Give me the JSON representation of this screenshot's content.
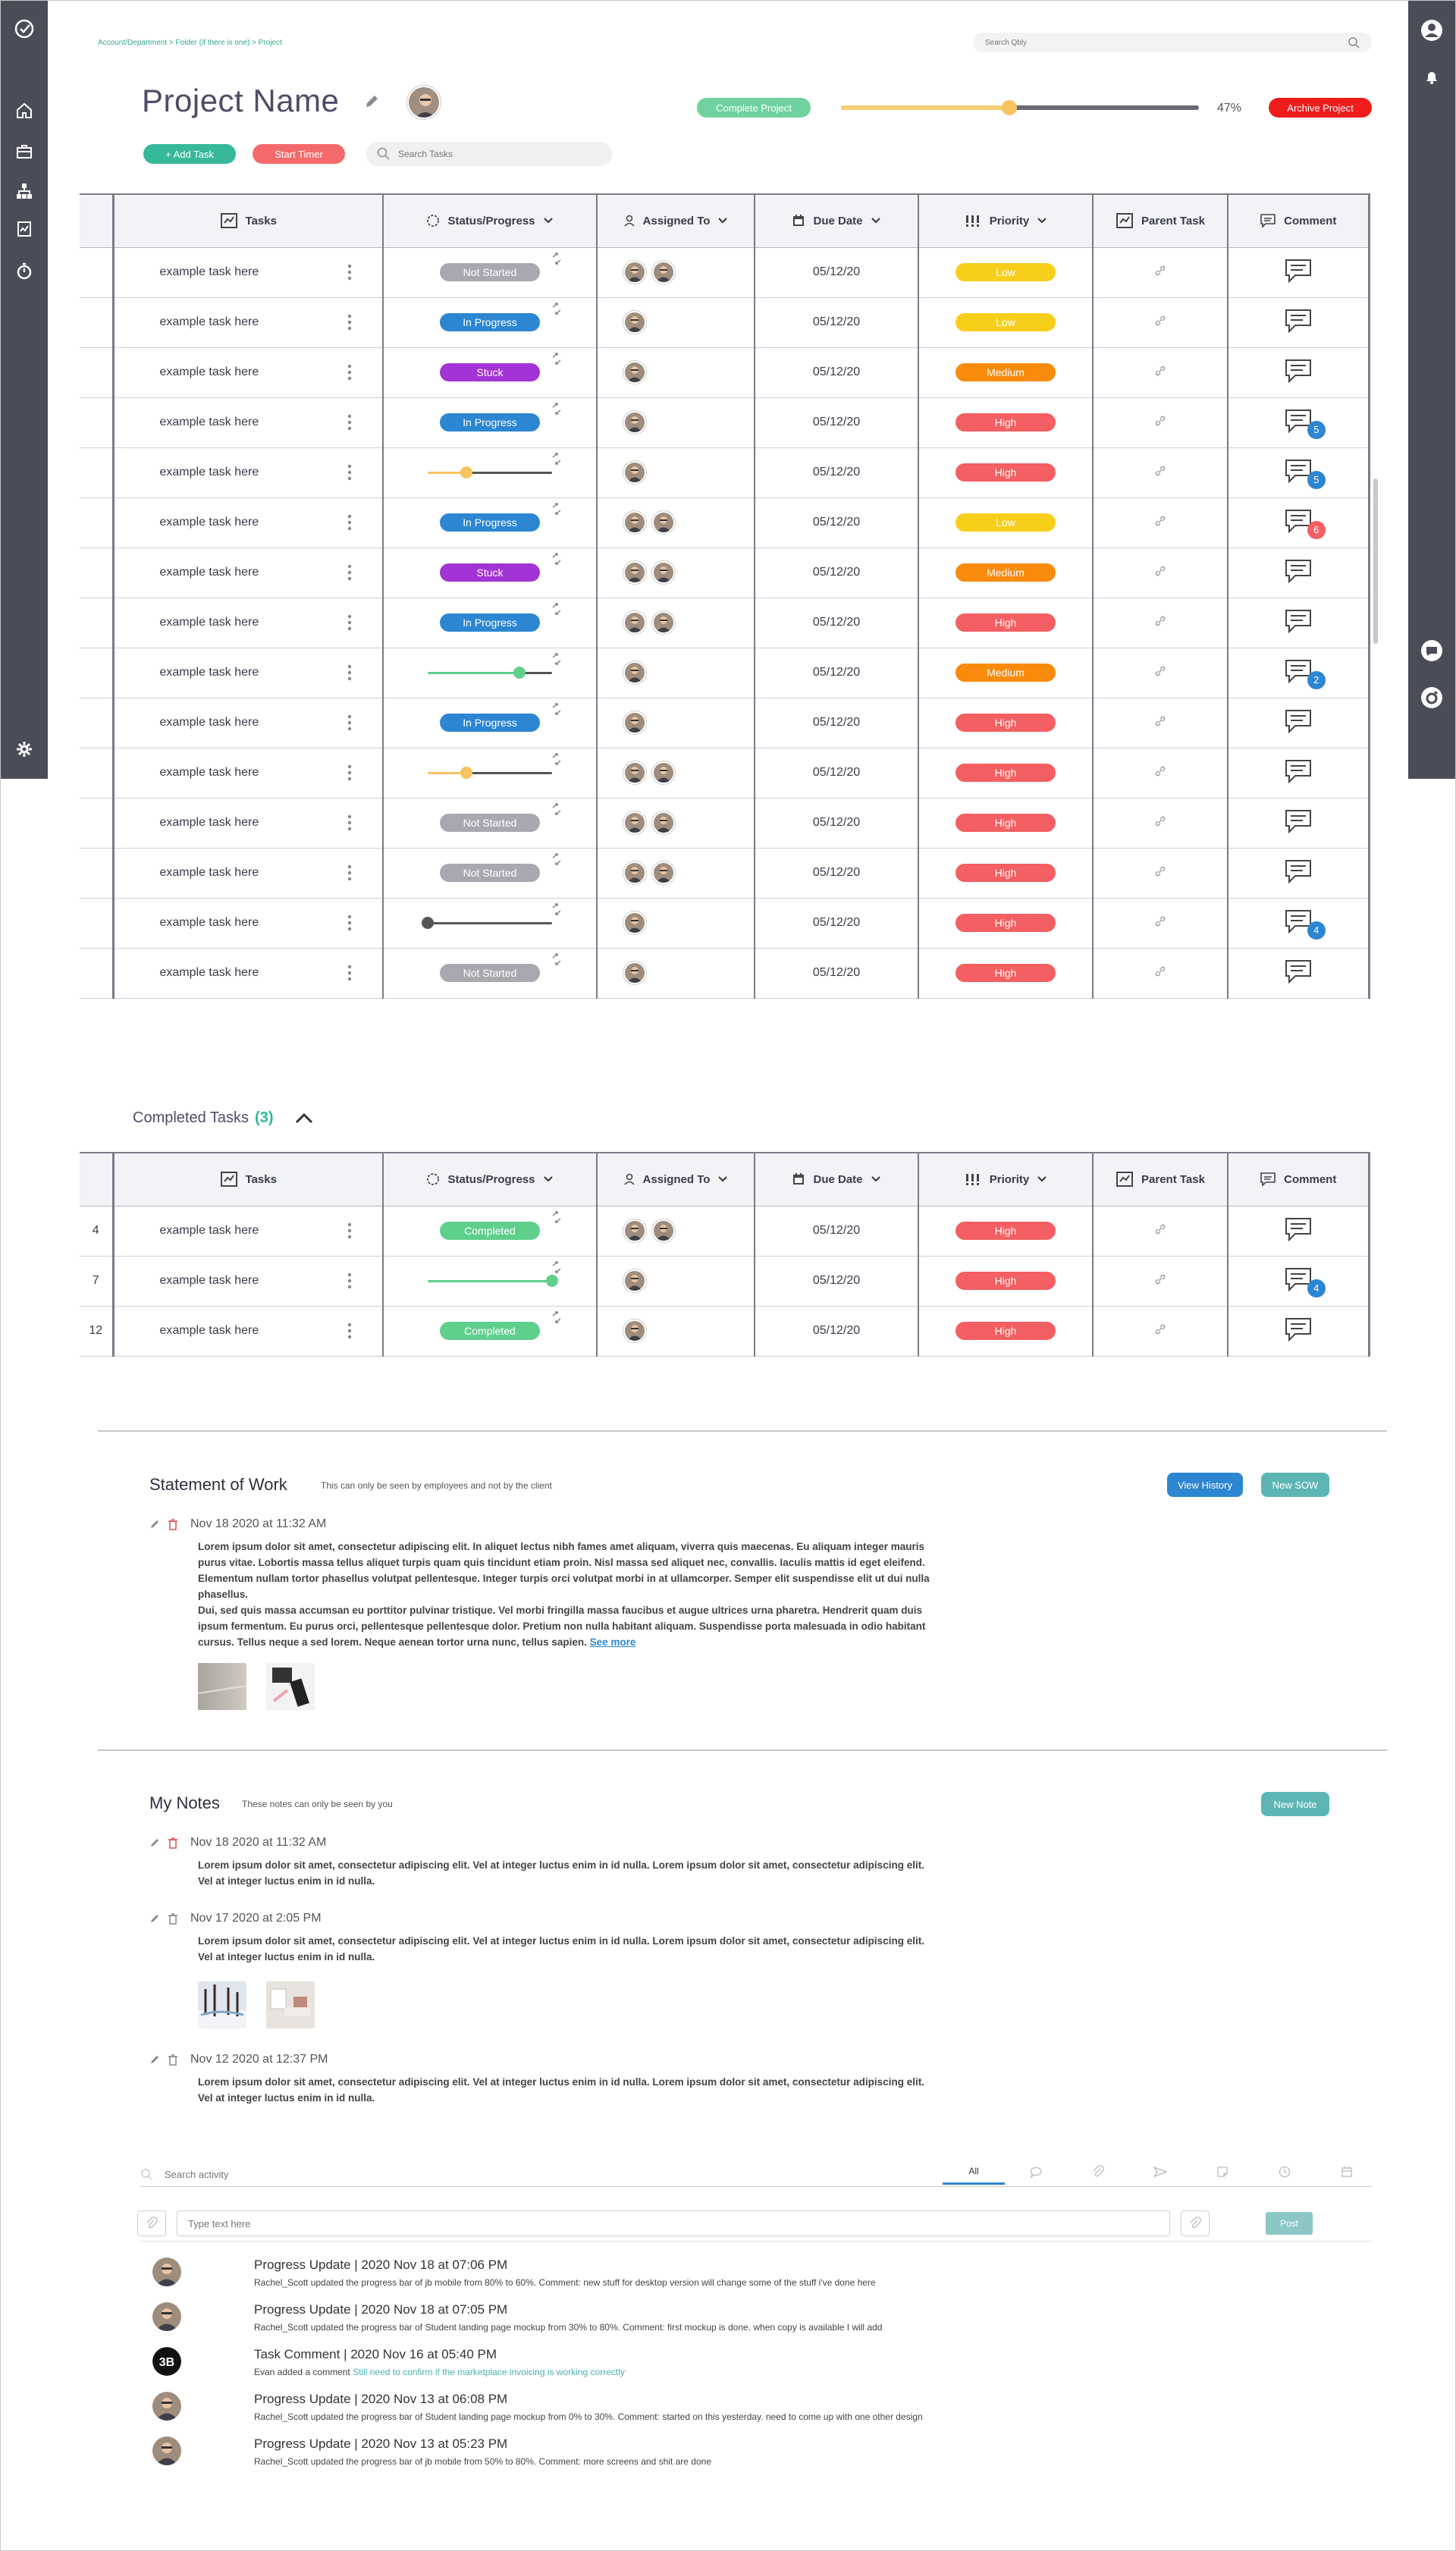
{
  "breadcrumb": "Account/Department > Folder (if there is one) > Project",
  "global_search": {
    "placeholder": "Search Qbly"
  },
  "project": {
    "title": "Project Name",
    "progress_pct": 47,
    "progress_label": "47%"
  },
  "buttons": {
    "add_task": "+ Add Task",
    "start_timer": "Start Timer",
    "complete_project": "Complete Project",
    "archive_project": "Archive Project"
  },
  "task_search": {
    "placeholder": "Search Tasks"
  },
  "columns": [
    "Tasks",
    "Status/Progress",
    "Assigned To",
    "Due Date",
    "Priority",
    "Parent Task",
    "Comment"
  ],
  "tasks": [
    {
      "name": "example task here",
      "status": "Not Started",
      "kind": "not",
      "assignees": 2,
      "due": "05/12/20",
      "priority": "Low",
      "prio": "low",
      "badge": null
    },
    {
      "name": "example task here",
      "status": "In Progress",
      "kind": "prog",
      "assignees": 1,
      "due": "05/12/20",
      "priority": "Low",
      "prio": "low",
      "badge": null
    },
    {
      "name": "example task here",
      "status": "Stuck",
      "kind": "stuck",
      "assignees": 1,
      "due": "05/12/20",
      "priority": "Medium",
      "prio": "medium",
      "badge": null
    },
    {
      "name": "example task here",
      "status": "In Progress",
      "kind": "prog",
      "assignees": 1,
      "due": "05/12/20",
      "priority": "High",
      "prio": "high",
      "badge": "5",
      "badge_color": "blue"
    },
    {
      "name": "example task here",
      "status": "",
      "kind": "slider",
      "slider_pct": 0.31,
      "slider_color": "#f7c35f",
      "assignees": 1,
      "due": "05/12/20",
      "priority": "High",
      "prio": "high",
      "badge": "5",
      "badge_color": "blue"
    },
    {
      "name": "example task here",
      "status": "In Progress",
      "kind": "prog",
      "assignees": 2,
      "due": "05/12/20",
      "priority": "Low",
      "prio": "low",
      "badge": "6",
      "badge_color": "red"
    },
    {
      "name": "example task here",
      "status": "Stuck",
      "kind": "stuck",
      "assignees": 2,
      "due": "05/12/20",
      "priority": "Medium",
      "prio": "medium",
      "badge": null
    },
    {
      "name": "example task here",
      "status": "In Progress",
      "kind": "prog",
      "assignees": 2,
      "due": "05/12/20",
      "priority": "High",
      "prio": "high",
      "badge": null
    },
    {
      "name": "example task here",
      "status": "",
      "kind": "slider",
      "slider_pct": 0.74,
      "slider_color": "#5fcf8c",
      "assignees": 1,
      "due": "05/12/20",
      "priority": "Medium",
      "prio": "medium",
      "badge": "2",
      "badge_color": "blue"
    },
    {
      "name": "example task here",
      "status": "In Progress",
      "kind": "prog",
      "assignees": 1,
      "due": "05/12/20",
      "priority": "High",
      "prio": "high",
      "badge": null
    },
    {
      "name": "example task here",
      "status": "",
      "kind": "slider",
      "slider_pct": 0.31,
      "slider_color": "#f7c35f",
      "assignees": 2,
      "due": "05/12/20",
      "priority": "High",
      "prio": "high",
      "badge": null
    },
    {
      "name": "example task here",
      "status": "Not Started",
      "kind": "not",
      "assignees": 2,
      "due": "05/12/20",
      "priority": "High",
      "prio": "high",
      "badge": null
    },
    {
      "name": "example task here",
      "status": "Not Started",
      "kind": "not",
      "assignees": 2,
      "due": "05/12/20",
      "priority": "High",
      "prio": "high",
      "badge": null
    },
    {
      "name": "example task here",
      "status": "",
      "kind": "slider",
      "slider_pct": 0.0,
      "slider_color": "#555555",
      "assignees": 1,
      "due": "05/12/20",
      "priority": "High",
      "prio": "high",
      "badge": "4",
      "badge_color": "blue"
    },
    {
      "name": "example task here",
      "status": "Not Started",
      "kind": "not",
      "assignees": 1,
      "due": "05/12/20",
      "priority": "High",
      "prio": "high",
      "badge": null
    }
  ],
  "completed": {
    "label": "Completed Tasks",
    "count": "(3)",
    "tasks": [
      {
        "idx": "4",
        "name": "example task here",
        "status": "Completed",
        "kind": "done",
        "assignees": 2,
        "due": "05/12/20",
        "priority": "High",
        "prio": "high",
        "badge": null
      },
      {
        "idx": "7",
        "name": "example task here",
        "status": "",
        "kind": "slider",
        "slider_pct": 1.0,
        "slider_color": "#5fcf8c",
        "assignees": 1,
        "due": "05/12/20",
        "priority": "High",
        "prio": "high",
        "badge": "4",
        "badge_color": "blue"
      },
      {
        "idx": "12",
        "name": "example task here",
        "status": "Completed",
        "kind": "done",
        "assignees": 1,
        "due": "05/12/20",
        "priority": "High",
        "prio": "high",
        "badge": null
      }
    ]
  },
  "sow": {
    "title": "Statement of Work",
    "note": "This can only be seen by employees and not by the client",
    "view_history": "View History",
    "new_sow": "New SOW",
    "entry": {
      "date": "Nov 18 2020 at 11:32 AM",
      "text1": "Lorem ipsum dolor sit amet, consectetur adipiscing elit. In aliquet lectus nibh fames amet aliquam, viverra quis maecenas. Eu aliquam integer mauris purus vitae. Lobortis massa tellus aliquet turpis quam quis tincidunt etiam proin. Nisl massa sed aliquet nec, convallis. Iaculis mattis id eget eleifend. Elementum nullam tortor phasellus volutpat pellentesque. Integer turpis orci volutpat morbi in at ullamcorper. Semper elit suspendisse elit ut dui nulla phasellus.",
      "text2": "Dui, sed quis massa accumsan eu porttitor pulvinar tristique. Vel morbi fringilla massa faucibus et augue ultrices urna pharetra. Hendrerit quam duis ipsum fermentum. Eu purus orci, pellentesque pellentesque dolor. Pretium non nulla habitant aliquam. Suspendisse porta malesuada in odio habitant cursus. Tellus neque a sed lorem. Neque aenean tortor urna nunc, tellus sapien.",
      "see_more": "See more"
    }
  },
  "notes": {
    "title": "My Notes",
    "note": "These notes can only be seen by you",
    "new_note": "New Note",
    "entries": [
      {
        "date": "Nov 18 2020 at 11:32 AM",
        "text": "Lorem ipsum dolor sit amet, consectetur adipiscing elit. Vel at integer luctus enim in id nulla. Lorem ipsum dolor sit amet, consectetur adipiscing elit. Vel at integer luctus enim in id nulla."
      },
      {
        "date": "Nov 17 2020 at 2:05 PM",
        "text": "Lorem ipsum dolor sit amet, consectetur adipiscing elit. Vel at integer luctus enim in id nulla. Lorem ipsum dolor sit amet, consectetur adipiscing elit. Vel at integer luctus enim in id nulla."
      },
      {
        "date": "Nov 12 2020 at 12:37 PM",
        "text": "Lorem ipsum dolor sit amet, consectetur adipiscing elit. Vel at integer luctus enim in id nulla. Lorem ipsum dolor sit amet, consectetur adipiscing elit. Vel at integer luctus enim in id nulla."
      }
    ]
  },
  "activity": {
    "search_placeholder": "Search activity",
    "tab_all": "All",
    "post_placeholder": "Type text here",
    "post_button": "Post",
    "items": [
      {
        "title": "Progress Update | 2020 Nov 18 at 07:06 PM",
        "body": "Rachel_Scott updated the progress bar of jb mobile from 80% to 60%. Comment: new stuff for desktop version will change some of the stuff i've done here",
        "link": ""
      },
      {
        "title": "Progress Update | 2020 Nov 18 at 07:05 PM",
        "body": "Rachel_Scott updated the progress bar of Student landing page mockup from 30% to 80%. Comment: first mockup is done. when copy is available I will add",
        "link": ""
      },
      {
        "title": "Task Comment | 2020 Nov 16 at 05:40 PM",
        "body": "Evan added a comment ",
        "link": "Still need to confirm if the marketplace invoicing is working correctly"
      },
      {
        "title": "Progress Update | 2020 Nov 13 at 06:08 PM",
        "body": "Rachel_Scott updated the progress bar of Student landing page mockup from 0% to 30%. Comment: started on this yesterday. need to come up with one other design",
        "link": ""
      },
      {
        "title": "Progress Update | 2020 Nov 13 at 05:23 PM",
        "body": "Rachel_Scott updated the progress bar of jb mobile from 50% to 80%. Comment: more screens and shit are done",
        "link": ""
      }
    ]
  }
}
